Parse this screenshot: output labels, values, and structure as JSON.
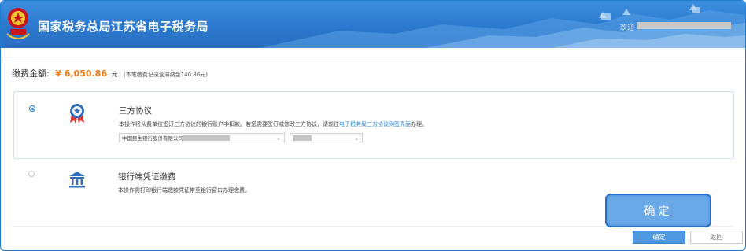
{
  "header": {
    "title": "国家税务总局江苏省电子税务局",
    "welcome": "欢迎",
    "emblem_text": "中国税务",
    "colors": {
      "bar": "#2a78cf",
      "emblem_red": "#c8161d"
    }
  },
  "payment": {
    "label": "缴费金额:",
    "value": "¥ 6,050.86",
    "unit": "元",
    "note": "(本笔缴费记录含滞纳金140.86元)"
  },
  "options": [
    {
      "title": "三方协议",
      "desc_prefix": "本操作将从费单位签订三方协议的银行账户中扣款。若您需要签订或修改三方协议，请前往",
      "desc_link": "电子税务局三方协议网签界面",
      "desc_suffix": "办理。",
      "bank_select": "中国民生银行股份有限公司",
      "selected": true,
      "icon": "badge-star-icon"
    },
    {
      "title": "银行端凭证缴费",
      "desc": "本操作需打印银行端缴款凭证带至银行窗口办理缴费。",
      "selected": false,
      "icon": "bank-building-icon"
    }
  ],
  "buttons": {
    "confirm_big": "确定",
    "confirm": "确定",
    "back": "返回"
  }
}
